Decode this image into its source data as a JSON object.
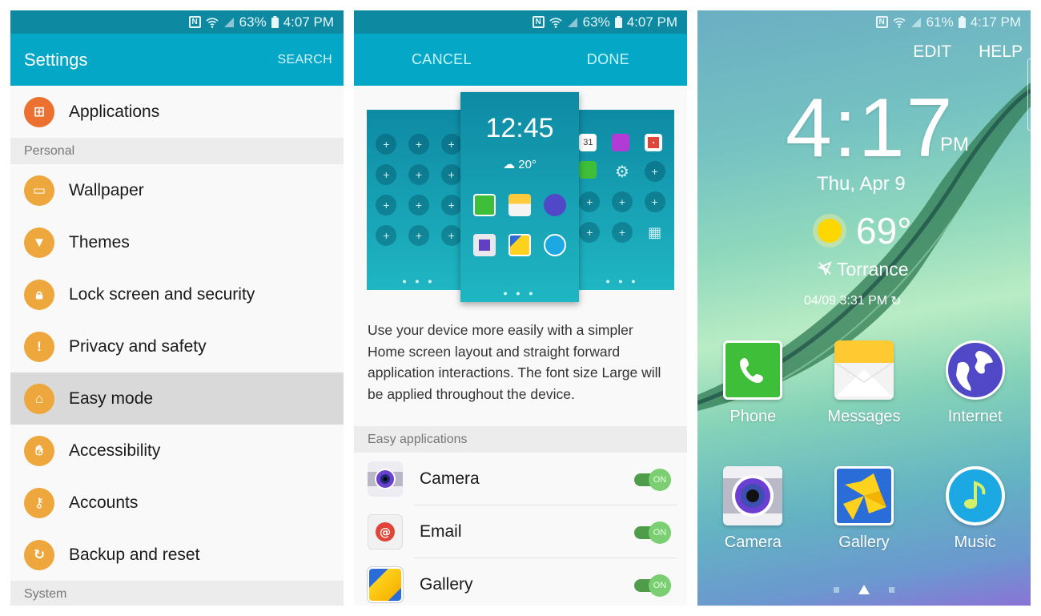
{
  "settings_screen": {
    "status": {
      "battery": "63%",
      "time": "4:07 PM"
    },
    "title": "Settings",
    "search_label": "SEARCH",
    "items": [
      {
        "type": "item",
        "label": "Applications",
        "icon": "apps-grid-icon",
        "color": "#ec7030"
      },
      {
        "type": "category",
        "label": "Personal"
      },
      {
        "type": "item",
        "label": "Wallpaper",
        "icon": "wallpaper-icon",
        "color": "#eda73c"
      },
      {
        "type": "item",
        "label": "Themes",
        "icon": "paint-brush-icon",
        "color": "#eda73c"
      },
      {
        "type": "item",
        "label": "Lock screen and security",
        "icon": "lock-icon",
        "color": "#eda73c"
      },
      {
        "type": "item",
        "label": "Privacy and safety",
        "icon": "privacy-alert-icon",
        "color": "#eda73c"
      },
      {
        "type": "item",
        "label": "Easy mode",
        "icon": "easy-mode-home-icon",
        "color": "#eda73c",
        "selected": true
      },
      {
        "type": "item",
        "label": "Accessibility",
        "icon": "hand-icon",
        "color": "#eda73c"
      },
      {
        "type": "item",
        "label": "Accounts",
        "icon": "key-icon",
        "color": "#eda73c"
      },
      {
        "type": "item",
        "label": "Backup and reset",
        "icon": "backup-restore-icon",
        "color": "#eda73c"
      },
      {
        "type": "category",
        "label": "System"
      }
    ]
  },
  "easy_mode_screen": {
    "status": {
      "battery": "63%",
      "time": "4:07 PM"
    },
    "cancel_label": "CANCEL",
    "done_label": "DONE",
    "preview": {
      "clock": "12:45",
      "temperature": "20°"
    },
    "description": "Use your device more easily with a simpler Home screen layout and straight forward application interactions. The font size Large will be applied throughout the device.",
    "section_label": "Easy applications",
    "apps": [
      {
        "name": "Camera",
        "toggle": "ON",
        "enabled": true
      },
      {
        "name": "Email",
        "toggle": "ON",
        "enabled": true
      },
      {
        "name": "Gallery",
        "toggle": "ON",
        "enabled": true
      }
    ]
  },
  "home_screen": {
    "status": {
      "battery": "61%",
      "time": "4:17 PM"
    },
    "edit_label": "EDIT",
    "help_label": "HELP",
    "clock": "4:17",
    "ampm": "PM",
    "date": "Thu, Apr 9",
    "temperature": "69°",
    "location": "Torrance",
    "updated": "04/09  3:31 PM",
    "apps": [
      {
        "label": "Phone"
      },
      {
        "label": "Messages"
      },
      {
        "label": "Internet"
      },
      {
        "label": "Camera"
      },
      {
        "label": "Gallery"
      },
      {
        "label": "Music"
      }
    ],
    "page_count": 3,
    "current_page": "home"
  }
}
